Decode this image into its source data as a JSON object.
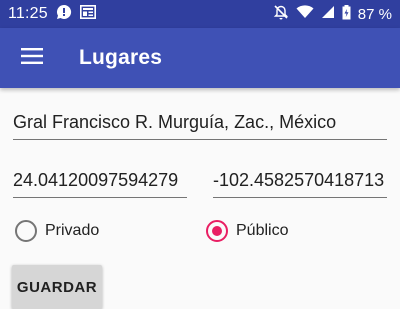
{
  "status_bar": {
    "time": "11:25",
    "battery": "87 %",
    "icons": [
      "chat-notification-icon",
      "news-notification-icon",
      "notifications-off-icon",
      "wifi-icon",
      "signal-icon",
      "battery-icon"
    ]
  },
  "app_bar": {
    "title": "Lugares",
    "menu_icon": "hamburger-menu-icon"
  },
  "form": {
    "address": "Gral Francisco R. Murguía, Zac., México",
    "latitude": "24.04120097594279",
    "longitude": "-102.4582570418713",
    "radio_options": [
      {
        "label": "Privado",
        "selected": false
      },
      {
        "label": "Público",
        "selected": true
      }
    ],
    "save_label": "GUARDAR"
  },
  "colors": {
    "status_bar": "#303f9f",
    "app_bar": "#3f51b5",
    "accent": "#e91e63"
  }
}
